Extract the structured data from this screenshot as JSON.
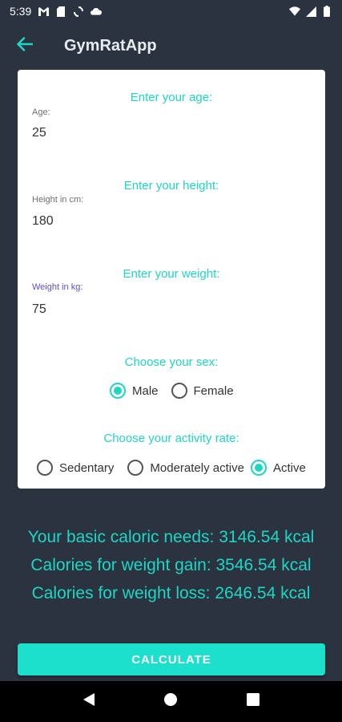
{
  "status_bar": {
    "time": "5:39",
    "left_icons": [
      "gmail-icon",
      "sim-icon",
      "sync-icon",
      "cloud-icon"
    ],
    "right_icons": [
      "wifi-icon",
      "signal-icon",
      "battery-icon"
    ]
  },
  "app_bar": {
    "title": "GymRatApp",
    "back_icon": "arrow-left-icon"
  },
  "form": {
    "age": {
      "section_title": "Enter your age:",
      "label": "Age:",
      "value": "25"
    },
    "height": {
      "section_title": "Enter your height:",
      "label": "Height in cm:",
      "value": "180"
    },
    "weight": {
      "section_title": "Enter your weight:",
      "label": "Weight in kg:",
      "value": "75"
    },
    "sex": {
      "section_title": "Choose your sex:",
      "options": [
        {
          "label": "Male",
          "checked": true
        },
        {
          "label": "Female",
          "checked": false
        }
      ]
    },
    "activity": {
      "section_title": "Choose your activity rate:",
      "options": [
        {
          "label": "Sedentary",
          "checked": false
        },
        {
          "label": "Moderately active",
          "checked": false
        },
        {
          "label": "Active",
          "checked": true
        }
      ]
    }
  },
  "results": {
    "basic": "Your basic caloric needs:  3146.54 kcal",
    "gain": "Calories for weight gain: 3546.54 kcal",
    "loss": "Calories for weight loss: 2646.54 kcal"
  },
  "calculate_button": {
    "label": "CALCULATE"
  },
  "colors": {
    "background": "#2b3340",
    "accent": "#1dd6c4",
    "button": "#1de0cc",
    "focused_label": "#5b4de0"
  }
}
